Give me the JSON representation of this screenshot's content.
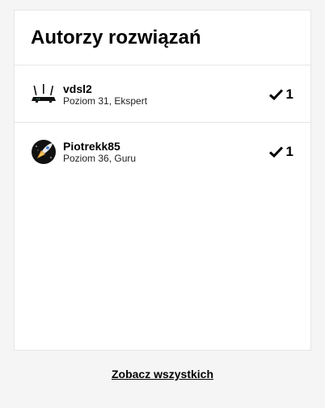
{
  "widget": {
    "title": "Autorzy rozwiązań",
    "see_all": "Zobacz wszystkich"
  },
  "authors": [
    {
      "name": "vdsl2",
      "meta": "Poziom 31, Ekspert",
      "solutions": "1",
      "avatar_icon": "router-icon"
    },
    {
      "name": "Piotrekk85",
      "meta": "Poziom 36, Guru",
      "solutions": "1",
      "avatar_icon": "rocket-icon"
    }
  ]
}
